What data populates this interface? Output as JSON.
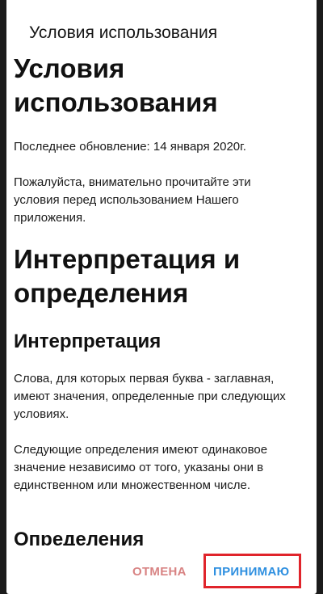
{
  "dialog": {
    "title": "Условия использования"
  },
  "document": {
    "heading": [
      "Условия",
      "использования"
    ],
    "last_updated": "Последнее обновление: 14 января 2020г.",
    "intro": "Пожалуйста, внимательно прочитайте эти условия перед использованием Нашего приложения.",
    "section_title": [
      "Интерпретация и",
      "определения"
    ],
    "subsection1_title": "Интерпретация",
    "subsection1_text": "Слова, для которых первая буква - заглавная, имеют значения, определенные при следующих условиях.",
    "subsection1_text2": "Следующие определения имеют одинаковое значение независимо от того, указаны они в единственном или множественном числе.",
    "subsection2_title": "Определения"
  },
  "actions": {
    "cancel_label": "ОТМЕНА",
    "accept_label": "ПРИНИМАЮ",
    "accept_highlight_color": "#e0242b",
    "accept_color": "#2e8fe0",
    "cancel_color": "#d88383"
  }
}
